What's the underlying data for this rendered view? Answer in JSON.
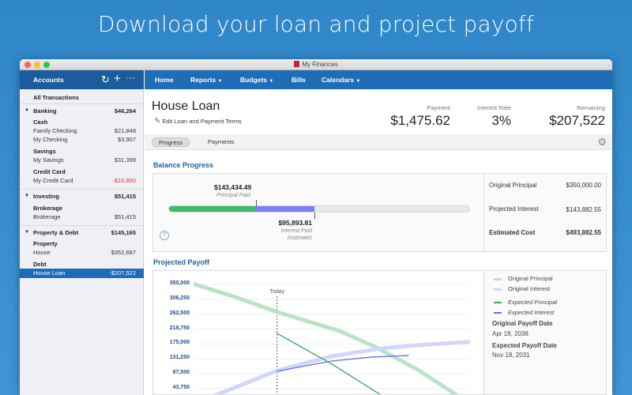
{
  "headline": "Download your loan and project payoff",
  "window": {
    "title": "My Finances"
  },
  "sidebar": {
    "title": "Accounts",
    "all_transactions": "All Transactions",
    "groups": [
      {
        "name": "Banking",
        "total": "$46,264"
      },
      {
        "name": "Investing",
        "total": "$51,415"
      },
      {
        "name": "Property & Debt",
        "total": "$145,165"
      }
    ],
    "subgroups": [
      "Cash",
      "Savings",
      "Credit Card",
      "Brokerage",
      "Property",
      "Debt"
    ],
    "accounts": [
      {
        "name": "Family Checking",
        "amount": "$21,848"
      },
      {
        "name": "My Checking",
        "amount": "$3,907"
      },
      {
        "name": "My Savings",
        "amount": "$31,399"
      },
      {
        "name": "My Credit Card",
        "amount": "-$10,890"
      },
      {
        "name": "Brokerage",
        "amount": "$51,415"
      },
      {
        "name": "House",
        "amount": "$352,687"
      },
      {
        "name": "House Loan",
        "amount": "-$207,522"
      }
    ]
  },
  "nav": {
    "home": "Home",
    "reports": "Reports",
    "budgets": "Budgets",
    "bills": "Bills",
    "calendars": "Calendars"
  },
  "loan": {
    "title": "House Loan",
    "edit": "Edit Loan and Payment Terms",
    "payment_label": "Payment",
    "payment": "$1,475.62",
    "rate_label": "Interest Rate",
    "rate": "3%",
    "remaining_label": "Remaining",
    "remaining": "$207,522"
  },
  "tabs": {
    "progress": "Progress",
    "payments": "Payments"
  },
  "balance": {
    "title": "Balance Progress",
    "principal_paid": "$143,434.49",
    "principal_paid_label": "Principal Paid",
    "interest_paid": "$95,893.81",
    "interest_paid_label": "Interest Paid",
    "interest_paid_note": "(estimate)",
    "principal_fraction": 0.2904,
    "interest_fraction": 0.1942,
    "original_principal_label": "Original Principal",
    "original_principal": "$350,000.00",
    "projected_interest_label": "Projected Interest",
    "projected_interest": "$143,882.55",
    "estimated_cost_label": "Estimated Cost",
    "estimated_cost": "$493,882.55",
    "help": "?"
  },
  "payoff": {
    "title": "Projected Payoff",
    "today_label": "Today",
    "legend": {
      "orig_principal": "Original Principal",
      "orig_interest": "Original Interest",
      "exp_principal": "Expected Principal",
      "exp_interest": "Expected Interest"
    },
    "original_date_label": "Original Payoff Date",
    "original_date": "Apr 18, 2038",
    "expected_date_label": "Expected Payoff Date",
    "expected_date": "Nov 18, 2031",
    "colors": {
      "orig_principal": "#b9e2c8",
      "orig_interest": "#d3d6fb",
      "exp_principal": "#3aa35a",
      "exp_interest": "#6a6ee0"
    }
  },
  "chart_data": {
    "type": "line",
    "title": "Projected Payoff",
    "yticks": [
      "350,000",
      "306,250",
      "262,500",
      "218,750",
      "175,000",
      "131,250",
      "87,500",
      "43,750"
    ],
    "ylim": [
      0,
      350000
    ],
    "xlim": [
      0,
      100
    ],
    "today_x": 30,
    "series": [
      {
        "name": "Original Principal",
        "points": [
          [
            0,
            350000
          ],
          [
            15,
            312000
          ],
          [
            30,
            269000
          ],
          [
            53,
            213000
          ],
          [
            67,
            162000
          ],
          [
            82,
            97000
          ],
          [
            96,
            23000
          ],
          [
            100,
            0
          ]
        ]
      },
      {
        "name": "Original Interest",
        "points": [
          [
            2,
            0
          ],
          [
            7,
            23000
          ],
          [
            30,
            97000
          ],
          [
            50,
            139000
          ],
          [
            68,
            162000
          ],
          [
            82,
            172000
          ],
          [
            100,
            181000
          ]
        ]
      },
      {
        "name": "Expected Principal",
        "points": [
          [
            30,
            206000
          ],
          [
            50,
            116000
          ],
          [
            73,
            0
          ]
        ]
      },
      {
        "name": "Expected Interest",
        "points": [
          [
            30,
            95000
          ],
          [
            50,
            125000
          ],
          [
            65,
            137000
          ],
          [
            78,
            141000
          ]
        ]
      }
    ]
  }
}
